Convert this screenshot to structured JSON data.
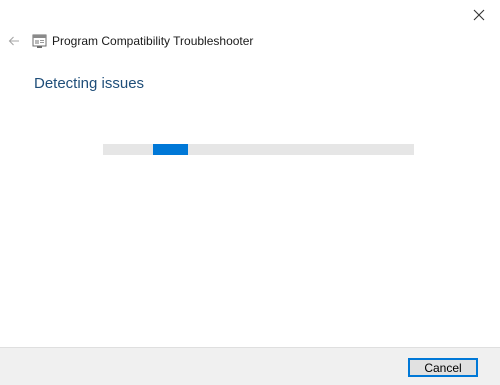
{
  "window": {
    "close_icon": "close-icon"
  },
  "header": {
    "back_icon": "back-arrow-icon",
    "app_icon": "troubleshooter-app-icon",
    "title": "Program Compatibility Troubleshooter"
  },
  "main": {
    "heading": "Detecting issues",
    "progress": {
      "type": "indeterminate",
      "position_fraction": 0.16,
      "accent_color": "#0078d7",
      "track_color": "#e6e6e6"
    }
  },
  "footer": {
    "cancel_label": "Cancel"
  },
  "colors": {
    "heading": "#1f4e79",
    "accent": "#0078d7",
    "footer_bg": "#f0f0f0"
  }
}
